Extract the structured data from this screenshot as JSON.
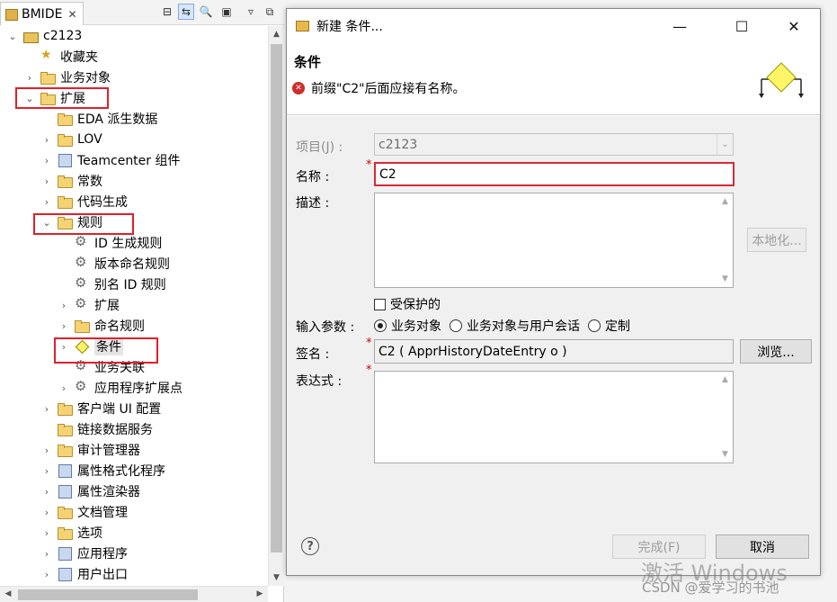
{
  "nav": {
    "tab_label": "BMIDE",
    "tab_close": "✕",
    "toolbar_icons": [
      "collapse-all-icon",
      "link-editor-icon",
      "search-icon",
      "package-icon",
      "view-menu-icon",
      "maximize-icon"
    ],
    "tree": [
      {
        "label": "c2123",
        "indent": 0,
        "chevron": "⌄",
        "icon": "project"
      },
      {
        "label": "收藏夹",
        "indent": 1,
        "chevron": "",
        "icon": "favorites"
      },
      {
        "label": "业务对象",
        "indent": 1,
        "chevron": "›",
        "icon": "folder"
      },
      {
        "label": "扩展",
        "indent": 1,
        "chevron": "⌄",
        "icon": "folder"
      },
      {
        "label": "EDA 派生数据",
        "indent": 2,
        "chevron": "",
        "icon": "folder"
      },
      {
        "label": "LOV",
        "indent": 2,
        "chevron": "›",
        "icon": "folder"
      },
      {
        "label": "Teamcenter 组件",
        "indent": 2,
        "chevron": "›",
        "icon": "generic"
      },
      {
        "label": "常数",
        "indent": 2,
        "chevron": "›",
        "icon": "folder"
      },
      {
        "label": "代码生成",
        "indent": 2,
        "chevron": "›",
        "icon": "folder"
      },
      {
        "label": "规则",
        "indent": 2,
        "chevron": "⌄",
        "icon": "folder"
      },
      {
        "label": "ID 生成规则",
        "indent": 3,
        "chevron": "",
        "icon": "rule"
      },
      {
        "label": "版本命名规则",
        "indent": 3,
        "chevron": "",
        "icon": "rule"
      },
      {
        "label": "别名 ID 规则",
        "indent": 3,
        "chevron": "",
        "icon": "rule"
      },
      {
        "label": "扩展",
        "indent": 3,
        "chevron": "›",
        "icon": "rule"
      },
      {
        "label": "命名规则",
        "indent": 3,
        "chevron": "›",
        "icon": "folder"
      },
      {
        "label": "条件",
        "indent": 3,
        "chevron": "›",
        "icon": "condition"
      },
      {
        "label": "业务关联",
        "indent": 3,
        "chevron": "",
        "icon": "rule"
      },
      {
        "label": "应用程序扩展点",
        "indent": 3,
        "chevron": "›",
        "icon": "rule"
      },
      {
        "label": "客户端 UI 配置",
        "indent": 2,
        "chevron": "›",
        "icon": "folder"
      },
      {
        "label": "链接数据服务",
        "indent": 2,
        "chevron": "",
        "icon": "folder"
      },
      {
        "label": "审计管理器",
        "indent": 2,
        "chevron": "›",
        "icon": "folder"
      },
      {
        "label": "属性格式化程序",
        "indent": 2,
        "chevron": "›",
        "icon": "generic"
      },
      {
        "label": "属性渲染器",
        "indent": 2,
        "chevron": "›",
        "icon": "generic"
      },
      {
        "label": "文档管理",
        "indent": 2,
        "chevron": "›",
        "icon": "folder"
      },
      {
        "label": "选项",
        "indent": 2,
        "chevron": "›",
        "icon": "folder"
      },
      {
        "label": "应用程序",
        "indent": 2,
        "chevron": "›",
        "icon": "generic"
      },
      {
        "label": "用户出口",
        "indent": 2,
        "chevron": "›",
        "icon": "generic"
      }
    ]
  },
  "dialog": {
    "window_title": "新建 条件...",
    "win_controls": {
      "minimize": "—",
      "maximize": "☐",
      "close": "✕"
    },
    "page_title": "条件",
    "error_message": "前缀\"C2\"后面应接有名称。",
    "fields": {
      "project_label": "项目(J) :",
      "project_value": "c2123",
      "name_label": "名称 :",
      "name_value": "C2",
      "desc_label": "描述 :",
      "desc_value": "",
      "localize_button": "本地化...",
      "protected_label": "受保护的",
      "input_params_label": "输入参数 :",
      "input_params_options": [
        {
          "label": "业务对象",
          "checked": true
        },
        {
          "label": "业务对象与用户会话",
          "checked": false
        },
        {
          "label": "定制",
          "checked": false
        }
      ],
      "signature_label": "签名 :",
      "signature_value": "C2 ( ApprHistoryDateEntry o )",
      "browse_button": "浏览...",
      "expression_label": "表达式 :",
      "expression_value": "",
      "required_mark": "*"
    },
    "footer": {
      "help": "?",
      "finish_button": "完成(F)",
      "cancel_button": "取消"
    }
  },
  "overlay": {
    "watermark": "激活 Windows",
    "credit": "CSDN @爱学习的书池"
  },
  "colors": {
    "annotation_red": "#e0202a",
    "error_red": "#d12c2c",
    "selection": "#e5e5e5"
  }
}
